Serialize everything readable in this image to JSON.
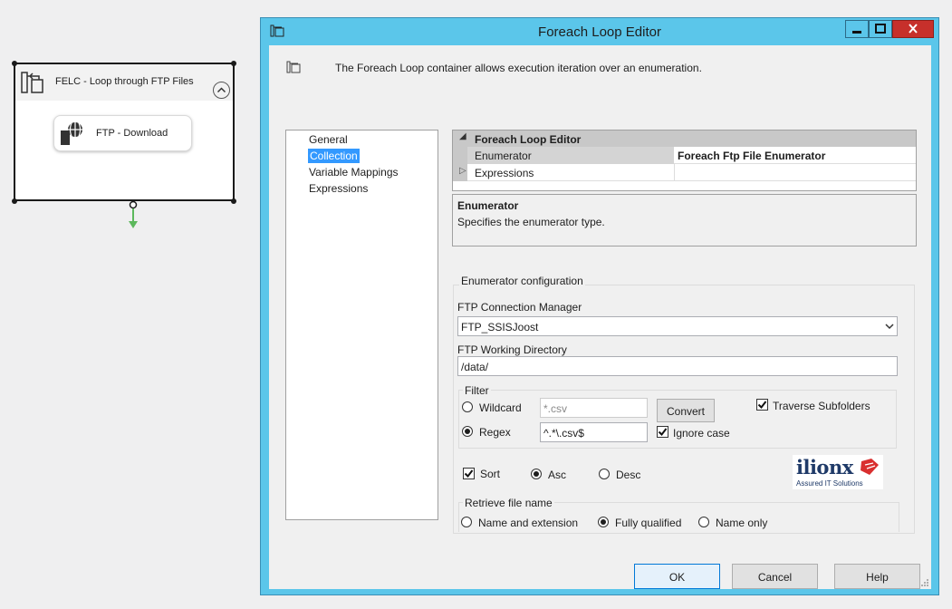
{
  "canvas": {
    "container_title": "FELC - Loop through FTP Files",
    "task_title": "FTP - Download"
  },
  "dialog": {
    "title": "Foreach Loop Editor",
    "description": "The Foreach Loop container allows execution iteration over an enumeration.",
    "nav": [
      "General",
      "Collection",
      "Variable Mappings",
      "Expressions"
    ],
    "nav_selected": "Collection",
    "grid": {
      "category": "Foreach Loop Editor",
      "enumerator_label": "Enumerator",
      "enumerator_value": "Foreach Ftp File Enumerator",
      "expressions_label": "Expressions"
    },
    "help": {
      "title": "Enumerator",
      "text": "Specifies the enumerator type."
    },
    "config": {
      "group_title": "Enumerator configuration",
      "ftp_conn_label": "FTP Connection Manager",
      "ftp_conn_value": "FTP_SSISJoost",
      "ftp_dir_label": "FTP Working Directory",
      "ftp_dir_value": "/data/",
      "filter_title": "Filter",
      "wildcard_label": "Wildcard",
      "wildcard_value": "*.csv",
      "regex_label": "Regex",
      "regex_value": "^.*\\.csv$",
      "convert_label": "Convert",
      "traverse_label": "Traverse Subfolders",
      "traverse_checked": true,
      "ignore_case_label": "Ignore case",
      "ignore_case_checked": true,
      "sort_label": "Sort",
      "sort_checked": true,
      "asc_label": "Asc",
      "desc_label": "Desc",
      "sort_order": "Asc",
      "filter_mode": "Regex",
      "retrieve_title": "Retrieve file name",
      "name_ext_label": "Name and extension",
      "fully_label": "Fully qualified",
      "name_only_label": "Name only",
      "retrieve_mode": "Fully qualified",
      "logo_text": "ilionx",
      "logo_tagline": "Assured IT Solutions"
    },
    "buttons": {
      "ok": "OK",
      "cancel": "Cancel",
      "help": "Help"
    }
  },
  "colors": {
    "title_bar": "#5bc6ea",
    "selection": "#3399ff",
    "close_button": "#c7302b"
  }
}
